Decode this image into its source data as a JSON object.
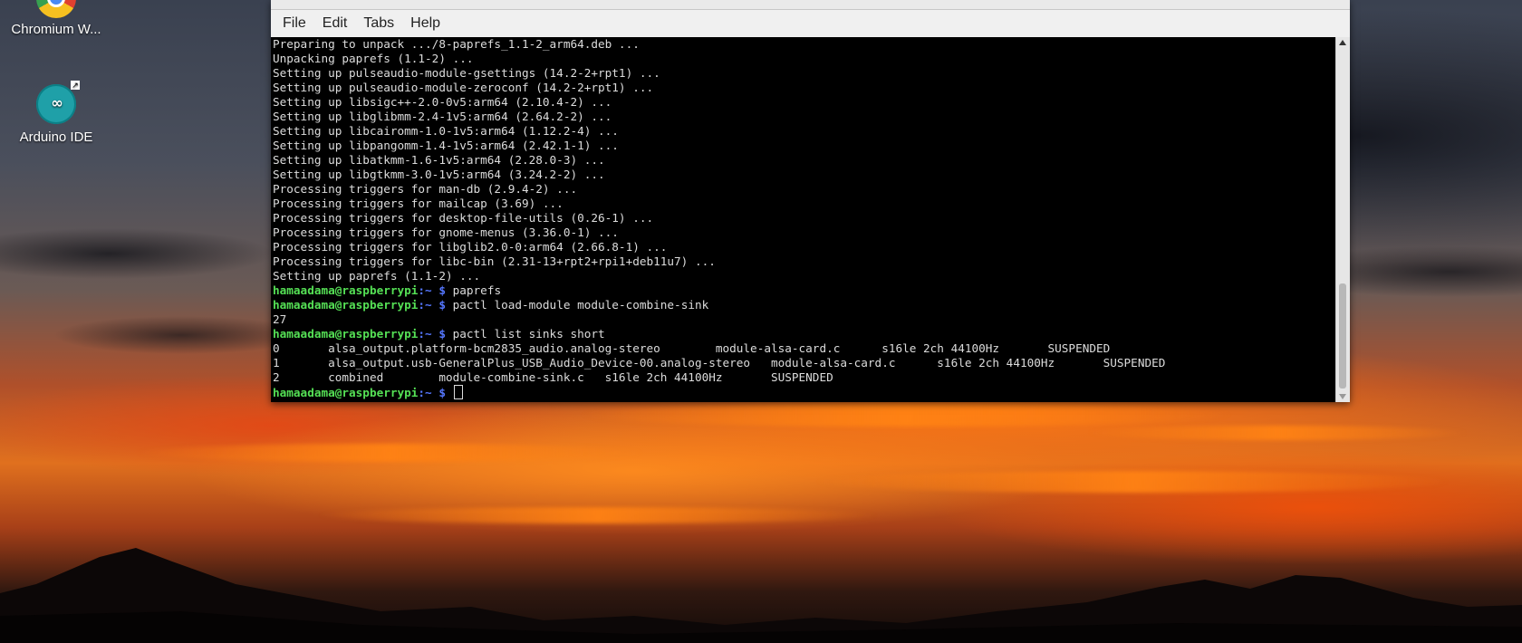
{
  "desktop": {
    "icons": [
      {
        "label": "Chromium W...",
        "icon": "chromium-icon"
      },
      {
        "label": "Arduino IDE",
        "icon": "arduino-icon",
        "glyph": "∞"
      }
    ]
  },
  "terminal": {
    "title": "",
    "menu": [
      "File",
      "Edit",
      "Tabs",
      "Help"
    ],
    "prompt_user": "hamaadama@raspberrypi",
    "prompt_path": ":~ $",
    "lines": [
      {
        "type": "out",
        "text": "Preparing to unpack .../8-paprefs_1.1-2_arm64.deb ..."
      },
      {
        "type": "out",
        "text": "Unpacking paprefs (1.1-2) ..."
      },
      {
        "type": "out",
        "text": "Setting up pulseaudio-module-gsettings (14.2-2+rpt1) ..."
      },
      {
        "type": "out",
        "text": "Setting up pulseaudio-module-zeroconf (14.2-2+rpt1) ..."
      },
      {
        "type": "out",
        "text": "Setting up libsigc++-2.0-0v5:arm64 (2.10.4-2) ..."
      },
      {
        "type": "out",
        "text": "Setting up libglibmm-2.4-1v5:arm64 (2.64.2-2) ..."
      },
      {
        "type": "out",
        "text": "Setting up libcairomm-1.0-1v5:arm64 (1.12.2-4) ..."
      },
      {
        "type": "out",
        "text": "Setting up libpangomm-1.4-1v5:arm64 (2.42.1-1) ..."
      },
      {
        "type": "out",
        "text": "Setting up libatkmm-1.6-1v5:arm64 (2.28.0-3) ..."
      },
      {
        "type": "out",
        "text": "Setting up libgtkmm-3.0-1v5:arm64 (3.24.2-2) ..."
      },
      {
        "type": "out",
        "text": "Processing triggers for man-db (2.9.4-2) ..."
      },
      {
        "type": "out",
        "text": "Processing triggers for mailcap (3.69) ..."
      },
      {
        "type": "out",
        "text": "Processing triggers for desktop-file-utils (0.26-1) ..."
      },
      {
        "type": "out",
        "text": "Processing triggers for gnome-menus (3.36.0-1) ..."
      },
      {
        "type": "out",
        "text": "Processing triggers for libglib2.0-0:arm64 (2.66.8-1) ..."
      },
      {
        "type": "out",
        "text": "Processing triggers for libc-bin (2.31-13+rpt2+rpi1+deb11u7) ..."
      },
      {
        "type": "out",
        "text": "Setting up paprefs (1.1-2) ..."
      },
      {
        "type": "cmd",
        "text": " paprefs"
      },
      {
        "type": "cmd",
        "text": " pactl load-module module-combine-sink"
      },
      {
        "type": "out",
        "text": "27"
      },
      {
        "type": "cmd",
        "text": " pactl list sinks short"
      },
      {
        "type": "out",
        "text": "0       alsa_output.platform-bcm2835_audio.analog-stereo        module-alsa-card.c      s16le 2ch 44100Hz       SUSPENDED"
      },
      {
        "type": "out",
        "text": "1       alsa_output.usb-GeneralPlus_USB_Audio_Device-00.analog-stereo   module-alsa-card.c      s16le 2ch 44100Hz       SUSPENDED"
      },
      {
        "type": "out",
        "text": "2       combined        module-combine-sink.c   s16le 2ch 44100Hz       SUSPENDED"
      },
      {
        "type": "prompt",
        "text": " "
      }
    ]
  }
}
